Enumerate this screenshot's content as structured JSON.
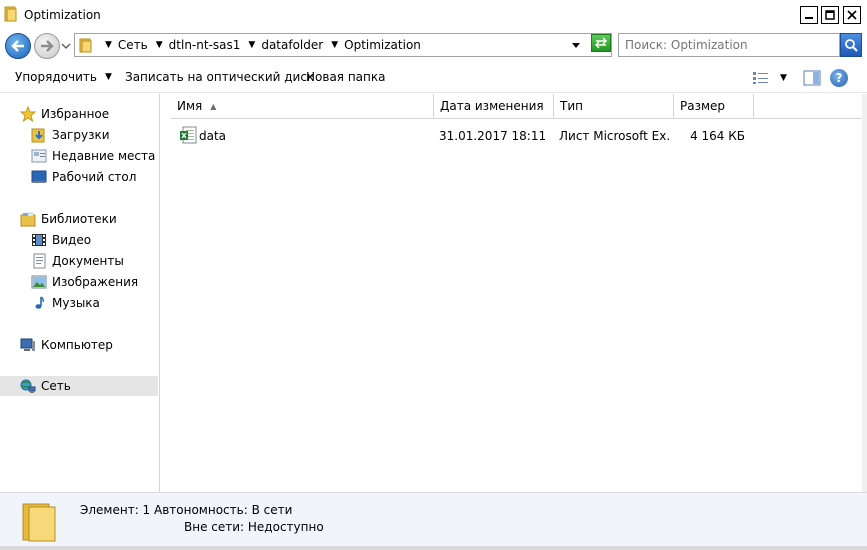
{
  "window": {
    "title": "Optimization",
    "title_icon": "folder-icon"
  },
  "address": {
    "crumbs": [
      "Сеть",
      "dtln-nt-sas1",
      "datafolder",
      "Optimization"
    ],
    "search_placeholder": "Поиск: Optimization"
  },
  "toolbar": {
    "organize_label": "Упорядочить",
    "burn_label": "Записать на оптический диск",
    "new_folder_label": "Новая папка"
  },
  "nav": {
    "favorites_label": "Избранное",
    "downloads_label": "Загрузки",
    "recent_label": "Недавние места",
    "desktop_label": "Рабочий стол",
    "libraries_label": "Библиотеки",
    "video_label": "Видео",
    "documents_label": "Документы",
    "pictures_label": "Изображения",
    "music_label": "Музыка",
    "computer_label": "Компьютер",
    "network_label": "Сеть",
    "selected": "network"
  },
  "columns": {
    "name": "Имя",
    "date": "Дата изменения",
    "type": "Тип",
    "size": "Размер"
  },
  "files": [
    {
      "name": "data",
      "date": "31.01.2017 18:11",
      "type": "Лист Microsoft Ex...",
      "size": "4 164 КБ",
      "icon": "excel-file-icon"
    }
  ],
  "details": {
    "line1": "Элемент: 1  Автономность:  В сети",
    "line2": "Вне сети:  Недоступно"
  },
  "colors": {
    "selected_nav": "#e5e5e5",
    "details_bg": "#f1f5fb",
    "accent_blue": "#1e63b8"
  }
}
